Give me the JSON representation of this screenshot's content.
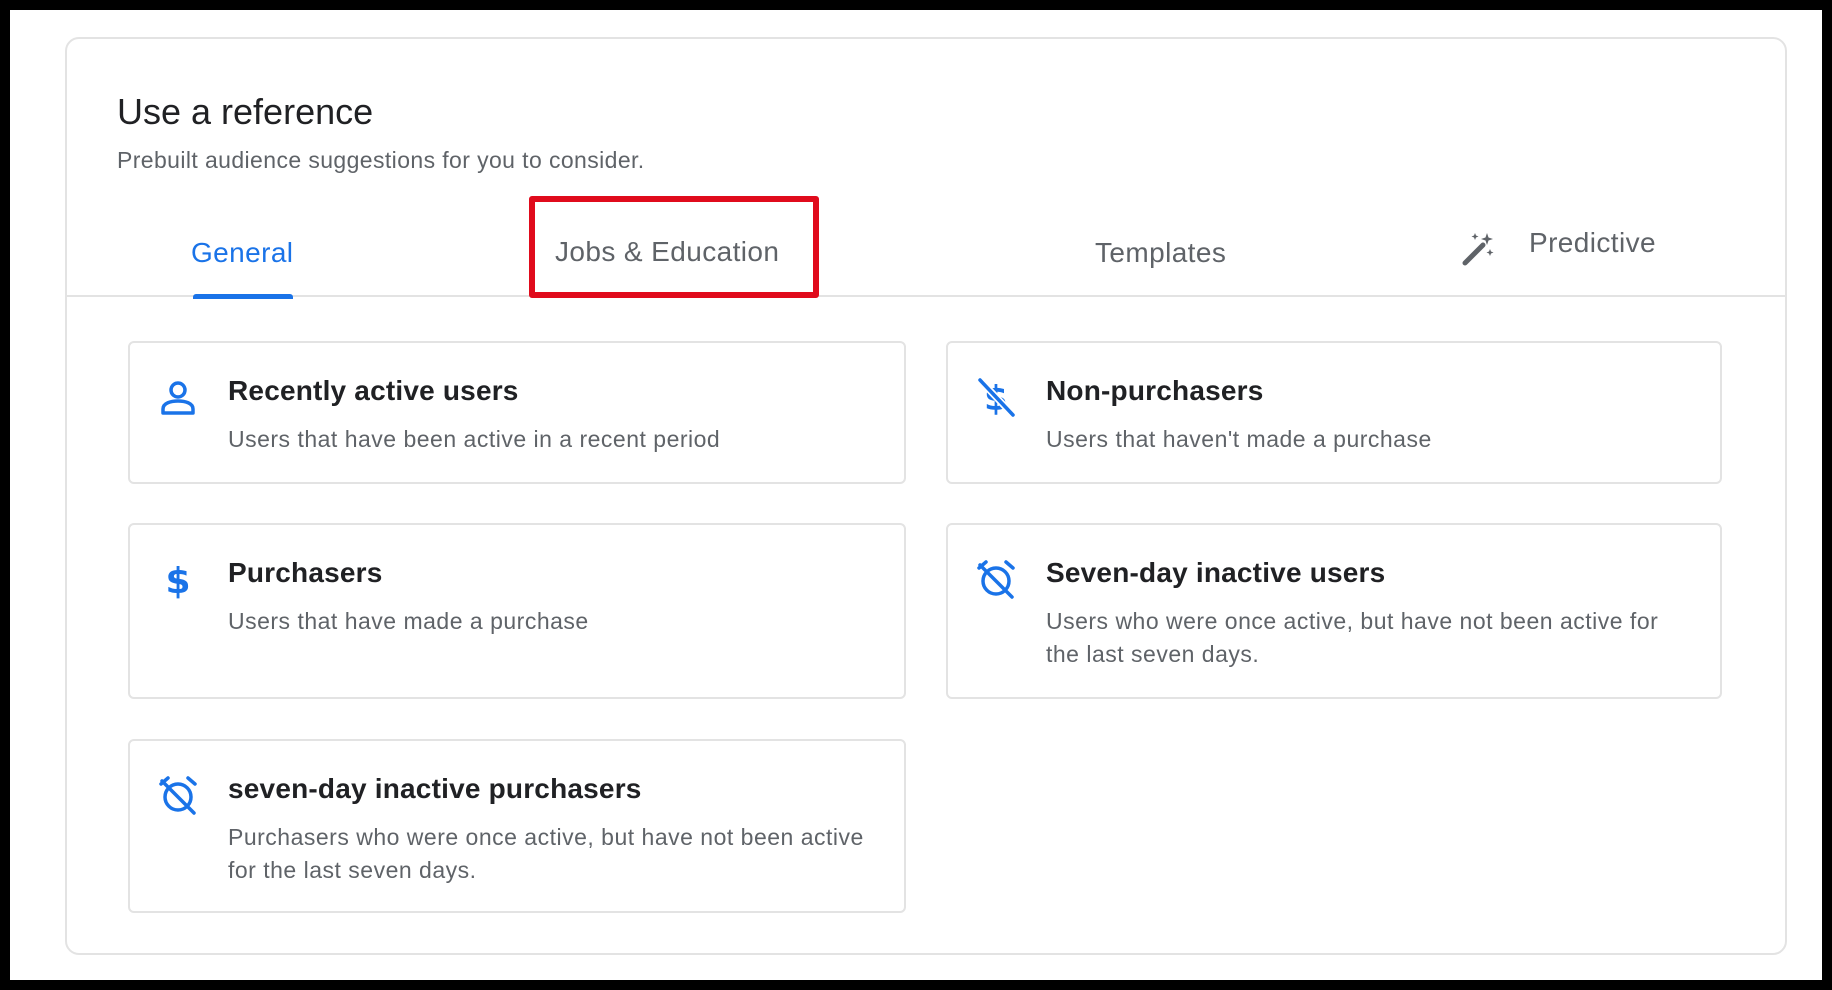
{
  "header": {
    "title": "Use a reference",
    "subtitle": "Prebuilt audience suggestions for you to consider."
  },
  "tabs": [
    {
      "label": "General",
      "active": true
    },
    {
      "label": "Jobs & Education",
      "highlighted": true
    },
    {
      "label": "Templates"
    },
    {
      "label": "Predictive",
      "icon": "magic-wand-icon"
    }
  ],
  "cards": [
    {
      "title": "Recently active users",
      "description": "Users that have been active in a recent period",
      "icon": "person-icon"
    },
    {
      "title": "Non-purchasers",
      "description": "Users that haven't made a purchase",
      "icon": "no-dollar-icon"
    },
    {
      "title": "Purchasers",
      "description": "Users that have made a purchase",
      "icon": "dollar-icon"
    },
    {
      "title": "Seven-day inactive users",
      "description": "Users who were once active, but have not been active for the last seven days.",
      "icon": "alarm-off-icon"
    },
    {
      "title": "seven-day inactive purchasers",
      "description": "Purchasers who were once active, but have not been active for the last seven days.",
      "icon": "alarm-off-icon"
    }
  ],
  "colors": {
    "accent": "#1a73e8",
    "highlight": "#e00b1c",
    "text_primary": "#202124",
    "text_secondary": "#5f6368",
    "border": "#e3e3e3"
  }
}
